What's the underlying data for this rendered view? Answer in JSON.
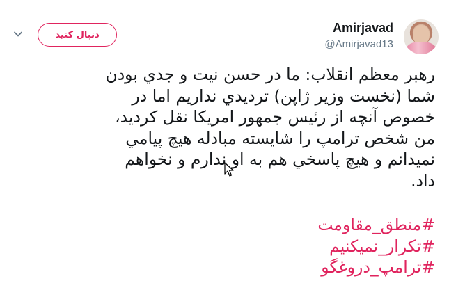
{
  "author": {
    "name": "Amirjavad",
    "handle": "@Amirjavad13"
  },
  "actions": {
    "follow_label": "دنبال کنید",
    "menu_icon": "chevron-down-icon"
  },
  "tweet": {
    "lines": [
      "رهبر معظم انقلاب: ما در حسن نیت و جدي بودن",
      "شما (نخست وزیر ژاپن) تردیدي نداریم اما در",
      "خصوص آنچه از رئیس جمهور امریکا نقل کردید،",
      "من شخص ترامپ را شایسته مبادله هیچ پیامي",
      "نميدانم و هیچ پاسخي هم به او ندارم و نخواهم",
      "داد."
    ],
    "hashtags": [
      "#منطق_مقاومت",
      "#تکرار_نمیکنیم",
      "#ترامپ_دروغگو"
    ]
  },
  "colors": {
    "accent": "#e0245e",
    "text": "#14171a",
    "secondary": "#657786"
  }
}
